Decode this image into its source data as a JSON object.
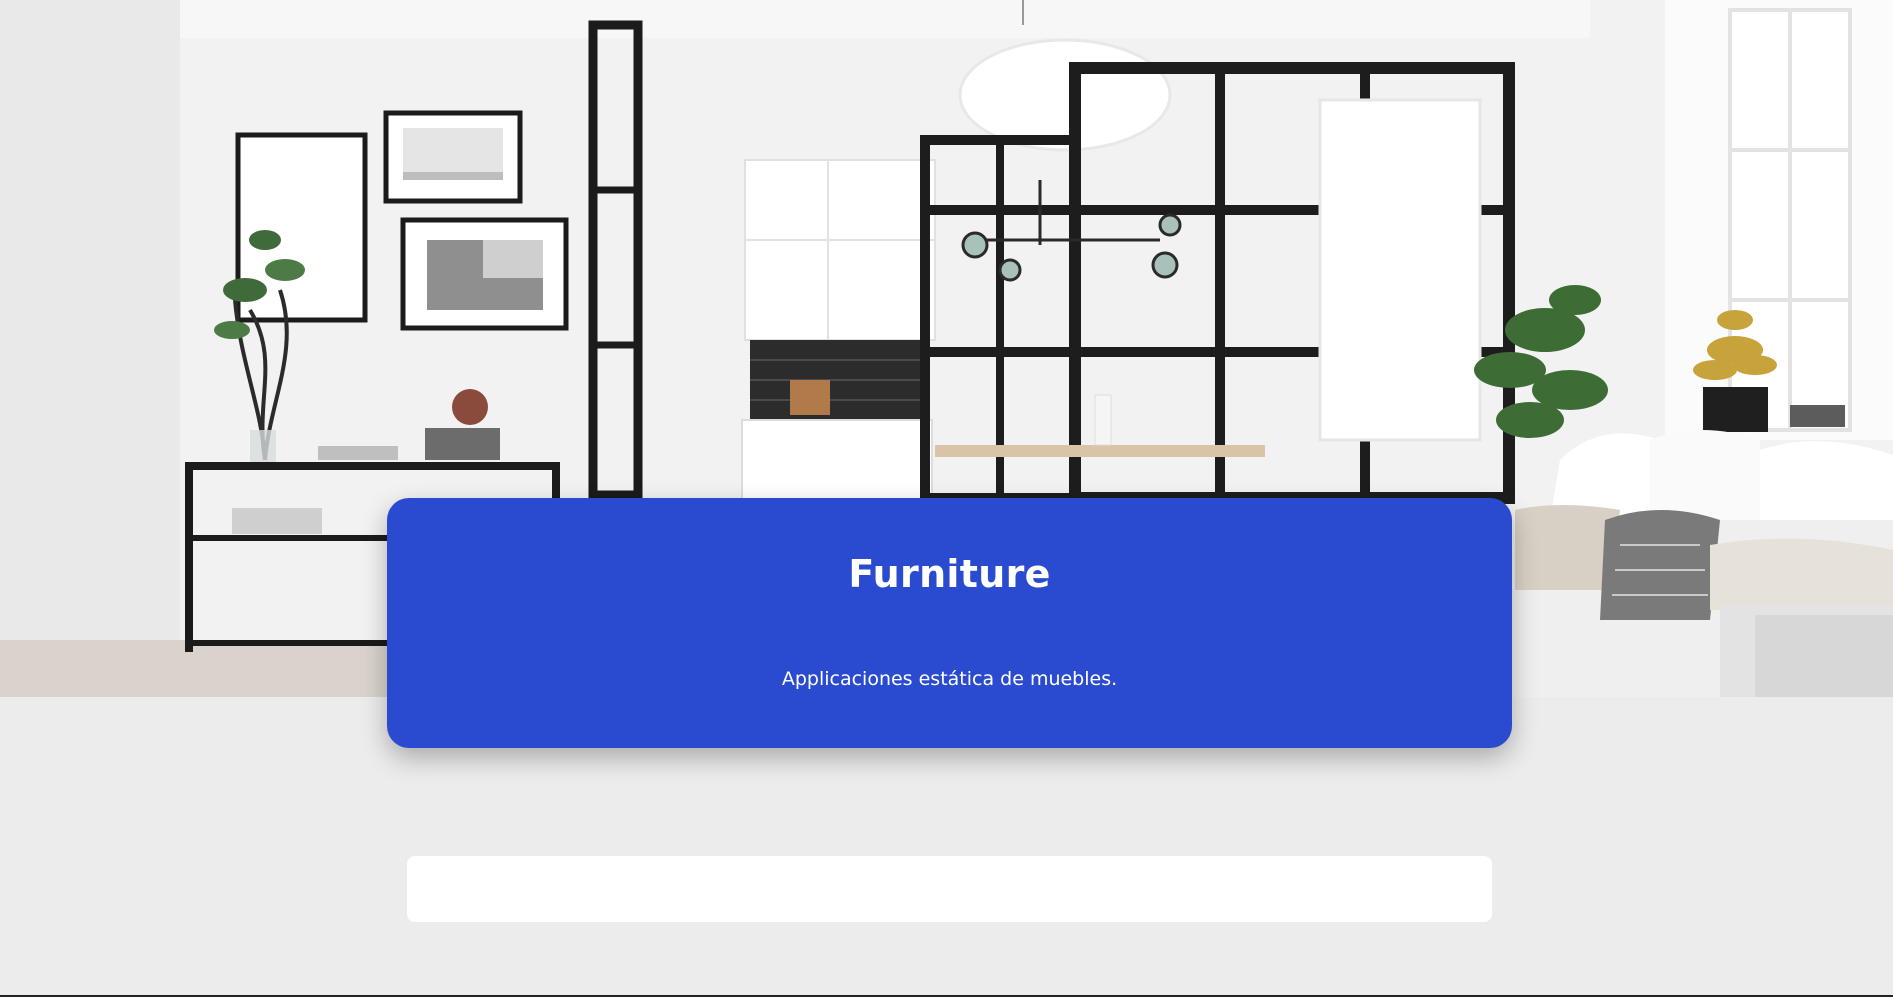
{
  "hero": {
    "image_name": "interior-living-room-kitchen-photo"
  },
  "card": {
    "title": "Furniture",
    "subtitle": "Applicaciones estática de muebles.",
    "background_color": "#2a4bcf",
    "text_color": "#ffffff"
  },
  "colors": {
    "page_background": "#ececec",
    "content_bar": "#ffffff"
  }
}
